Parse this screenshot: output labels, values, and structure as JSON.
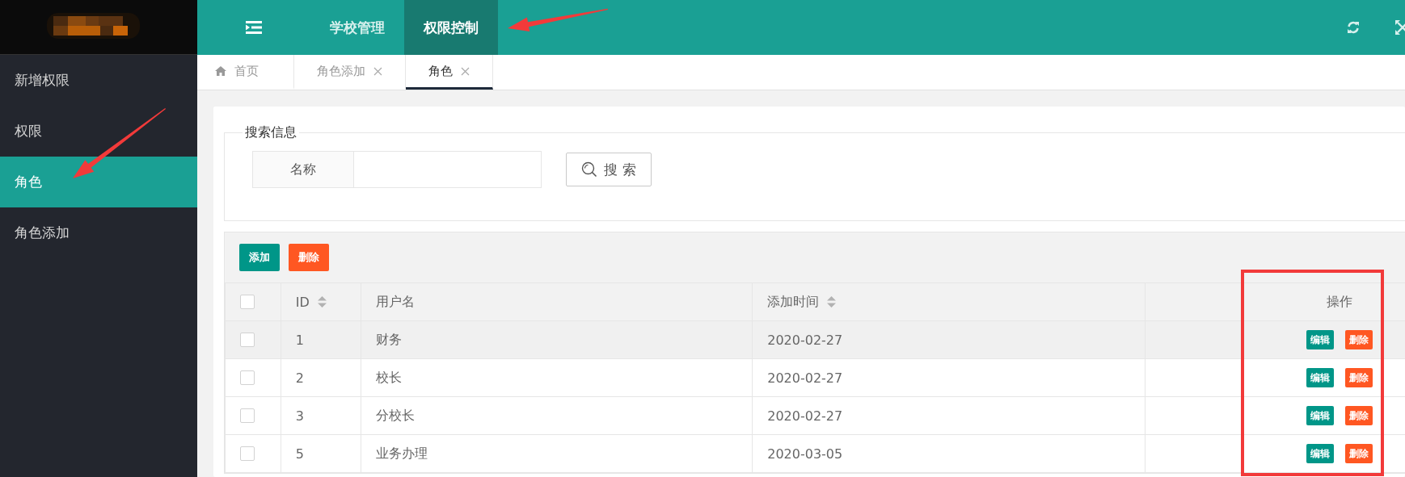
{
  "top_nav": {
    "items": [
      {
        "label": "学校管理",
        "selected": false
      },
      {
        "label": "权限控制",
        "selected": true
      }
    ]
  },
  "sidebar": {
    "items": [
      {
        "label": "新增权限",
        "selected": false
      },
      {
        "label": "权限",
        "selected": false
      },
      {
        "label": "角色",
        "selected": true
      },
      {
        "label": "角色添加",
        "selected": false
      }
    ]
  },
  "tabs": [
    {
      "label": "首页",
      "kind": "home",
      "selected": false
    },
    {
      "label": "角色添加",
      "kind": "closable",
      "selected": false
    },
    {
      "label": "角色",
      "kind": "closable",
      "selected": true
    }
  ],
  "search": {
    "legend": "搜索信息",
    "field_label": "名称",
    "button": "搜 索"
  },
  "toolbar": [
    {
      "label": "添加",
      "kind": "primary"
    },
    {
      "label": "删除",
      "kind": "danger"
    }
  ],
  "table": {
    "header_checked": false,
    "columns": [
      {
        "label": "ID",
        "sortable": true
      },
      {
        "label": "用户名",
        "sortable": false
      },
      {
        "label": "添加时间",
        "sortable": true
      }
    ],
    "actions_label": "操作",
    "rows": [
      {
        "checked": false,
        "hover": true,
        "id": "1",
        "name": "财务",
        "added": "2020-02-27",
        "actions": [
          {
            "label": "编辑",
            "kind": "primary"
          },
          {
            "label": "删除",
            "kind": "danger"
          }
        ]
      },
      {
        "checked": false,
        "hover": false,
        "id": "2",
        "name": "校长",
        "added": "2020-02-27",
        "actions": [
          {
            "label": "编辑",
            "kind": "primary"
          },
          {
            "label": "删除",
            "kind": "danger"
          }
        ]
      },
      {
        "checked": false,
        "hover": false,
        "id": "3",
        "name": "分校长",
        "added": "2020-02-27",
        "actions": [
          {
            "label": "编辑",
            "kind": "primary"
          },
          {
            "label": "删除",
            "kind": "danger"
          }
        ]
      },
      {
        "checked": false,
        "hover": false,
        "id": "5",
        "name": "业务办理",
        "added": "2020-03-05",
        "actions": [
          {
            "label": "编辑",
            "kind": "primary"
          },
          {
            "label": "删除",
            "kind": "danger"
          }
        ]
      }
    ]
  },
  "annotations": [
    {
      "kind": "arrow"
    },
    {
      "kind": "arrow"
    },
    {
      "kind": "box"
    }
  ]
}
